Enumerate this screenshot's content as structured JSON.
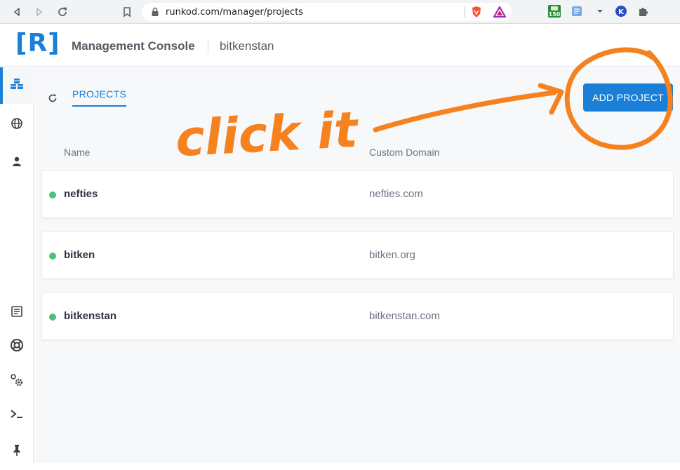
{
  "browser": {
    "url": "runkod.com/manager/projects",
    "badge_count": "150"
  },
  "header": {
    "logo": "[R]",
    "title": "Management Console",
    "account": "bitkenstan"
  },
  "sidebar": {
    "items": [
      {
        "icon": "cubes-icon",
        "active": true
      },
      {
        "icon": "globe-icon",
        "active": false
      },
      {
        "icon": "user-icon",
        "active": false
      },
      {
        "icon": "document-icon",
        "active": false
      },
      {
        "icon": "lifebuoy-icon",
        "active": false
      },
      {
        "icon": "settings-icon",
        "active": false
      },
      {
        "icon": "terminal-icon",
        "active": false
      },
      {
        "icon": "pin-icon",
        "active": false
      }
    ]
  },
  "main": {
    "tab_label": "PROJECTS",
    "add_button_label": "ADD PROJECT",
    "columns": {
      "name": "Name",
      "domain": "Custom Domain"
    },
    "projects": [
      {
        "name": "nefties",
        "domain": "nefties.com",
        "status": "active"
      },
      {
        "name": "bitken",
        "domain": "bitken.org",
        "status": "active"
      },
      {
        "name": "bitkenstan",
        "domain": "bitkenstan.com",
        "status": "active"
      }
    ]
  },
  "annotation": {
    "text": "click it",
    "color": "#f5811f"
  },
  "colors": {
    "accent": "#1a7fd6",
    "status_active": "#4cc276"
  }
}
